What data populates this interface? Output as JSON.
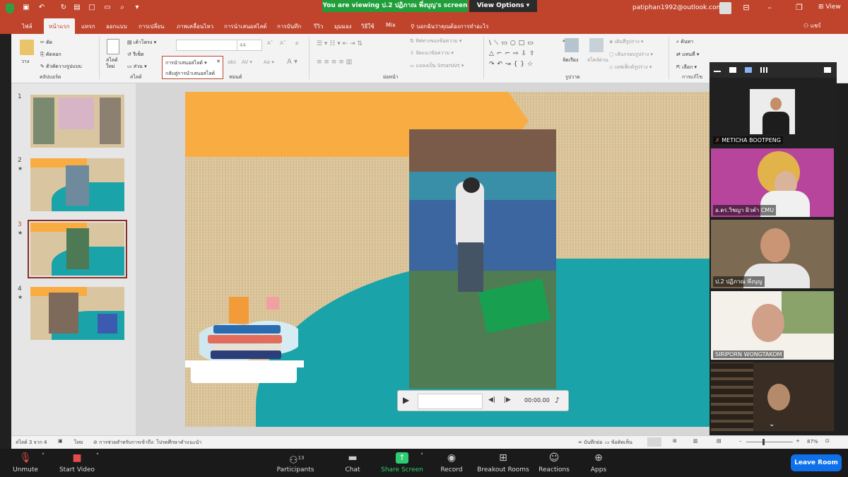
{
  "zoom_banner": {
    "viewing": "You are viewing ป.2 ปฏิภาณ พึ่งบุญ's screen",
    "view_options": "View Options"
  },
  "titlebar": {
    "email": "patiphan1992@outlook.com",
    "view": "View"
  },
  "ribbon_tabs": [
    "ไฟล์",
    "หน้าแรก",
    "แทรก",
    "ออกแบบ",
    "การเปลี่ยน",
    "ภาพเคลื่อนไหว",
    "การนำเสนอสไลด์",
    "การบันทึก",
    "รีวิว",
    "มุมมอง",
    "วิธีใช้",
    "Mix",
    "บอกฉันว่าคุณต้องการทำอะไร"
  ],
  "share": "แชร์",
  "ribbon": {
    "paste": "วาง",
    "cut": "ตัด",
    "copy": "คัดลอก",
    "format_painter": "ตัวคัดวางรูปแบบ",
    "clipboard": "คลิปบอร์ด",
    "new_slide": "สไลด์ใหม่",
    "layout": "เค้าโครง",
    "reset": "รีเซ็ต",
    "section": "ส่วน",
    "slides": "สไลด์",
    "font_size": "44",
    "font": "ฟอนต์",
    "paragraph": "ย่อหน้า",
    "text_direction": "ทิศทางของข้อความ",
    "align_text": "จัดแนวข้อความ",
    "smartart": "แปลงเป็น SmartArt",
    "arrange": "จัดเรียง",
    "quick_styles": "สไตล์ด่วน",
    "shape_fill": "เติมสีรูปร่าง",
    "shape_outline": "เส้นกรอบรูปร่าง",
    "shape_effects": "เอฟเฟ็กต์รูปร่าง",
    "drawing": "รูปวาด",
    "find": "ค้นหา",
    "replace": "แทนที่",
    "select": "เลือก",
    "editing": "การแก้ไข"
  },
  "popup": {
    "line1": "การนำเสนอสไลด์",
    "line2": "กลับสู่การนำเสนอสไลด์"
  },
  "thumbnails": [
    {
      "num": "1",
      "star": ""
    },
    {
      "num": "2",
      "star": "★"
    },
    {
      "num": "3",
      "star": "★"
    },
    {
      "num": "4",
      "star": "★"
    }
  ],
  "player": {
    "time": "00:00.00"
  },
  "participants": [
    {
      "name": "METICHA BOOTPENG"
    },
    {
      "name": "อ.ดร.วิชญา ผิวคำ CMU"
    },
    {
      "name": "ป.2 ปฏิภาณ พึ่งบุญ"
    },
    {
      "name": "SIRIPORN WONGTAKOM"
    }
  ],
  "statusbar": {
    "slide_of": "สไลด์ 3 จาก 4",
    "lang": "ไทย",
    "accessibility": "การช่วยสำหรับการเข้าถึง: โปรดศึกษาคำแนะนำ",
    "notes": "บันทึกย่อ",
    "comments": "ข้อคิดเห็น",
    "zoom": "87%"
  },
  "toolbar": {
    "unmute": "Unmute",
    "start_video": "Start Video",
    "participants": "Participants",
    "participants_count": "13",
    "chat": "Chat",
    "share_screen": "Share Screen",
    "record": "Record",
    "breakout": "Breakout Rooms",
    "reactions": "Reactions",
    "apps": "Apps",
    "leave": "Leave Room"
  },
  "colors": {
    "titlebar": "#c0432c",
    "zoom_green": "#1f9e3a",
    "leave": "#0e71eb",
    "slide_orange": "#f8ac42",
    "slide_teal": "#1aa3a8"
  }
}
